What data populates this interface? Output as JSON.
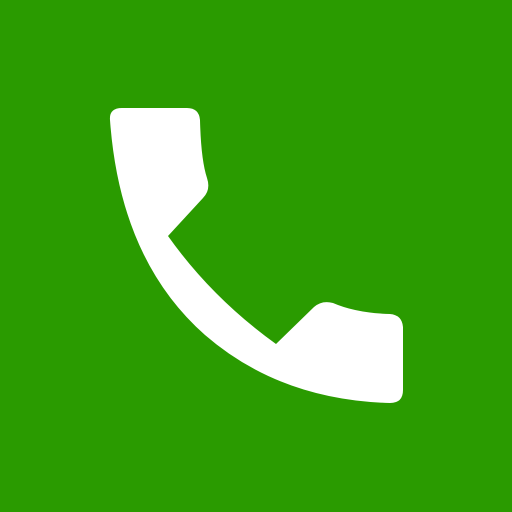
{
  "app_icon": {
    "icon": "phone-handset-icon",
    "background_color": "#2a9b00",
    "glyph_color": "#ffffff"
  }
}
